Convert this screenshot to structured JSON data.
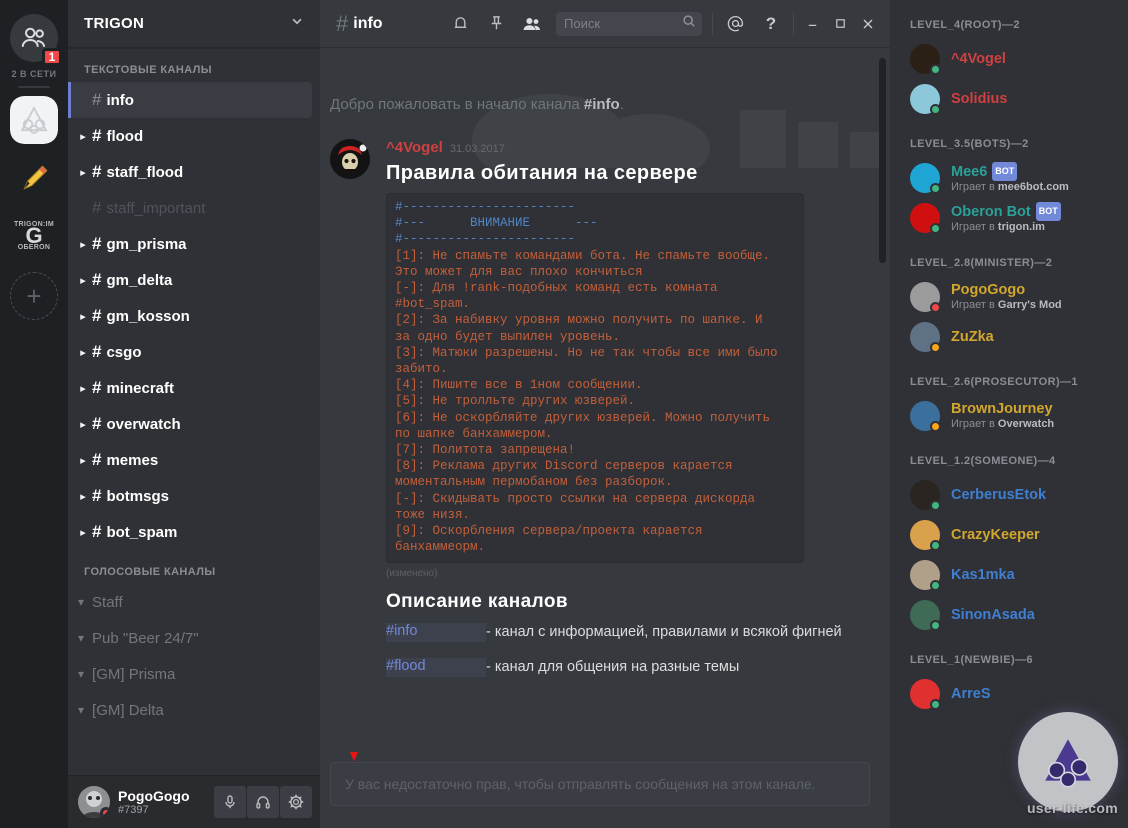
{
  "rail": {
    "dm_icon": "friends-icon",
    "badge_count": "1",
    "online_label": "2 В СЕТИ",
    "servers": [
      {
        "name": "TRIGON",
        "icon": "trigon-logo",
        "state": "active"
      },
      {
        "name": "pencil-server",
        "icon": "pencil-icon",
        "state": "unread"
      },
      {
        "name": "TRIGON.IM OBERON",
        "icon": "oberon-logo",
        "state": "unread",
        "line1": "TRIGON:IM",
        "line2": "G",
        "line3": "OБERON"
      }
    ],
    "add_label": "+"
  },
  "sidebar": {
    "guild_name": "TRIGON",
    "text_category": "ТЕКСТОВЫЕ КАНАЛЫ",
    "voice_category": "ГОЛОСОВЫЕ КАНАЛЫ",
    "text_channels": [
      {
        "name": "info",
        "state": "active"
      },
      {
        "name": "flood",
        "state": "unread"
      },
      {
        "name": "staff_flood",
        "state": "unread"
      },
      {
        "name": "staff_important",
        "state": "muted"
      },
      {
        "name": "gm_prisma",
        "state": "unread"
      },
      {
        "name": "gm_delta",
        "state": "unread"
      },
      {
        "name": "gm_kosson",
        "state": "unread"
      },
      {
        "name": "csgo",
        "state": "unread"
      },
      {
        "name": "minecraft",
        "state": "unread"
      },
      {
        "name": "overwatch",
        "state": "unread"
      },
      {
        "name": "memes",
        "state": "unread"
      },
      {
        "name": "botmsgs",
        "state": "unread"
      },
      {
        "name": "bot_spam",
        "state": "unread"
      }
    ],
    "voice_channels": [
      {
        "name": "Staff"
      },
      {
        "name": "Pub \"Beer 24/7\""
      },
      {
        "name": "[GM] Prisma"
      },
      {
        "name": "[GM] Delta"
      }
    ],
    "user": {
      "name": "PogoGogo",
      "tag": "#7397",
      "status_color": "#f04747",
      "buttons": [
        {
          "name": "mute-button",
          "icon": "microphone-icon"
        },
        {
          "name": "deafen-button",
          "icon": "headphones-icon"
        },
        {
          "name": "user-settings-button",
          "icon": "gear-icon"
        }
      ]
    }
  },
  "topbar": {
    "hash": "#",
    "channel": "info",
    "icons": [
      "bell-icon",
      "pin-icon",
      "members-icon"
    ],
    "search_placeholder": "Поиск",
    "search_value": "",
    "mention_icon": "@",
    "help_icon": "?",
    "window_controls": [
      "minimize",
      "maximize",
      "close"
    ]
  },
  "chat": {
    "welcome_prefix": "Добро пожаловать в начало канала ",
    "welcome_channel": "#info",
    "welcome_suffix": ".",
    "message": {
      "author": "^4Vogel",
      "author_color": "#d04040",
      "timestamp": "31.03.2017",
      "heading": "Правила обитания на сервере",
      "code_header": [
        "#-----------------------",
        "#---      ВНИМАНИЕ      ---",
        "#-----------------------"
      ],
      "code_body": "[1]: Не спамьте командами бота. Не спамьте вообще.\nЭто может для вас плохо кончиться\n[-]: Для !rank-подобных команд есть комната\n#bot_spam.\n[2]: За набивку уровня можно получить по шапке. И\nза одно будет выпилен уровень.\n[3]: Матюки разрешены. Но не так чтобы все ими было\nзабито.\n[4]: Пишите все в 1ном сообщении.\n[5]: Не тролльте других юзверей.\n[6]: Не оскорбляйте других юзверей. Можно получить\nпо шапке банхаммером.\n[7]: Политота запрещена!\n[8]: Реклама других Discord серверов карается\nмоментальным пермобаном без разборок.\n[-]: Скидывать просто ссылки на сервера дискорда\nтоже низя.\n[9]: Оскорбления сервера/проекта карается\nбанхаммеорм.",
      "edited_label": "(изменено)",
      "section_heading": "Описание каналов",
      "descriptions": [
        {
          "channel": "#info",
          "text": "- канал с информацией, правилами и всякой фигней"
        },
        {
          "channel": "#flood",
          "text": "- канал для общения на разные темы"
        }
      ]
    },
    "composer_placeholder": "У вас недостаточно прав, чтобы отправлять сообщения на этом канале."
  },
  "members": {
    "groups": [
      {
        "title": "LEVEL_4(ROOT)—2",
        "users": [
          {
            "name": "^4Vogel",
            "color": "#d04040",
            "status": "#43b581",
            "game": "",
            "bot": false,
            "avatar": "#2a2015"
          },
          {
            "name": "Solidius",
            "color": "#d04040",
            "status": "#43b581",
            "game": "",
            "bot": false,
            "avatar": "#8cc7da"
          }
        ]
      },
      {
        "title": "LEVEL_3.5(BOTS)—2",
        "users": [
          {
            "name": "Mee6",
            "color": "#2aa198",
            "status": "#43b581",
            "game": "Играет в ",
            "game_bold": "mee6bot.com",
            "bot": true,
            "bot_label": "BOT",
            "avatar": "#1ea5d4"
          },
          {
            "name": "Oberon Bot",
            "color": "#2aa198",
            "status": "#43b581",
            "game": "Играет в ",
            "game_bold": "trigon.im",
            "bot": true,
            "bot_label": "BOT",
            "avatar": "#d01010"
          }
        ]
      },
      {
        "title": "LEVEL_2.8(MINISTER)—2",
        "users": [
          {
            "name": "PogoGogo",
            "color": "#d3a72c",
            "status": "#f04747",
            "game": "Играет в ",
            "game_bold": "Garry's Mod",
            "bot": false,
            "avatar": "#9b9b9b"
          },
          {
            "name": "ZuZka",
            "color": "#d3a72c",
            "status": "#faa61a",
            "game": "",
            "bot": false,
            "avatar": "#5f7285"
          }
        ]
      },
      {
        "title": "LEVEL_2.6(PROSECUTOR)—1",
        "users": [
          {
            "name": "BrownJourney",
            "color": "#d3a72c",
            "status": "#faa61a",
            "game": "Играет в ",
            "game_bold": "Overwatch",
            "bot": false,
            "avatar": "#3b6f9c"
          }
        ]
      },
      {
        "title": "LEVEL_1.2(SOMEONE)—4",
        "users": [
          {
            "name": "CerberusEtok",
            "color": "#3f7fd1",
            "status": "#43b581",
            "game": "",
            "bot": false,
            "avatar": "#2a2520"
          },
          {
            "name": "CrazyKeeper",
            "color": "#d3a72c",
            "status": "#43b581",
            "game": "",
            "bot": false,
            "avatar": "#d9a14c"
          },
          {
            "name": "Kas1mka",
            "color": "#3f7fd1",
            "status": "#43b581",
            "game": "",
            "bot": false,
            "avatar": "#b0a08a"
          },
          {
            "name": "SinonAsada",
            "color": "#3f7fd1",
            "status": "#43b581",
            "game": "",
            "bot": false,
            "avatar": "#3f6a55"
          }
        ]
      },
      {
        "title": "LEVEL_1(NEWBIE)—6",
        "users": [
          {
            "name": "ArreS",
            "color": "#3f7fd1",
            "status": "#43b581",
            "game": "",
            "bot": false,
            "avatar": "#e03030"
          }
        ]
      }
    ]
  },
  "watermark": {
    "text": "user-life.com"
  }
}
